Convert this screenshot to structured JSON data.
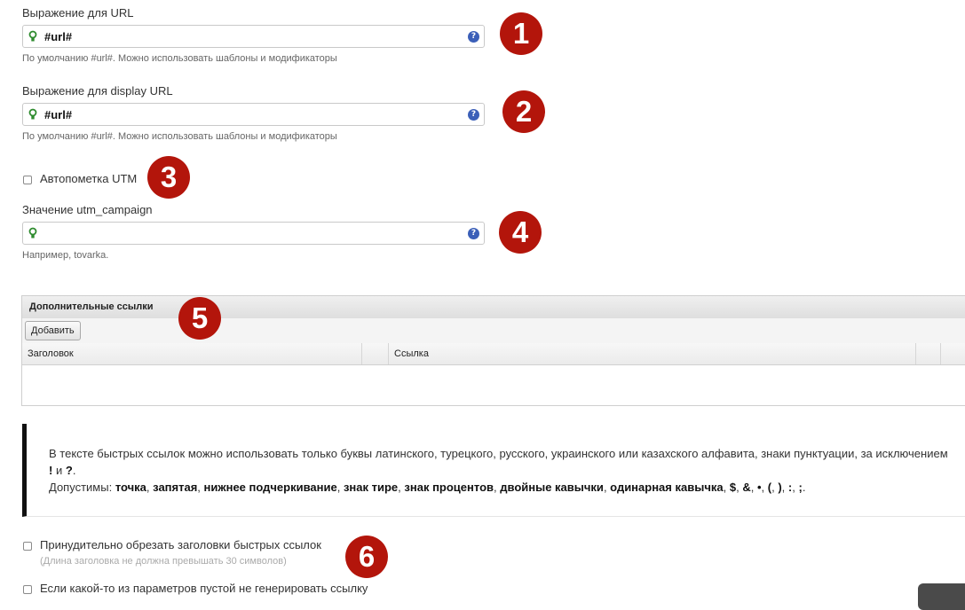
{
  "url_expr": {
    "label": "Выражение для URL",
    "value": "#url#",
    "hint": "По умолчанию #url#. Можно использовать шаблоны и модификаторы"
  },
  "display_url_expr": {
    "label": "Выражение для display URL",
    "value": "#url#",
    "hint": "По умолчанию #url#. Можно использовать шаблоны и модификаторы"
  },
  "utm_autotag": {
    "label": "Автопометка UTM"
  },
  "utm_campaign": {
    "label": "Значение utm_campaign",
    "value": "",
    "hint": "Например, tovarka."
  },
  "extra_links": {
    "title": "Дополнительные ссылки",
    "add_button": "Добавить",
    "columns": [
      "Заголовок",
      "Ссылка"
    ]
  },
  "note": {
    "line1": "В тексте быстрых ссылок можно использовать только буквы латинского, турецкого, русского, украинского или казахского алфавита, знаки пунктуации, за исключением",
    "excl_1": "!",
    "and": "и",
    "excl_2": "?",
    "dot_end": ".",
    "allowed_prefix": "Допустимы:",
    "allowed": [
      "точка",
      "запятая",
      "нижнее подчеркивание",
      "знак тире",
      "знак процентов",
      "двойные кавычки",
      "одинарная кавычка",
      "$",
      "&",
      "•",
      "(",
      ")",
      ":",
      ";"
    ]
  },
  "truncate_titles": {
    "label": "Принудительно обрезать заголовки быстрых ссылок",
    "hint": "(Длина заголовка не должна превышать 30 символов)"
  },
  "skip_empty": {
    "label": "Если какой-то из параметров пустой не генерировать ссылку"
  },
  "badges": [
    "1",
    "2",
    "3",
    "4",
    "5",
    "6"
  ],
  "help_glyph": "?",
  "colors": {
    "badge": "#b3150b",
    "help": "#3b5fb8",
    "bulb": "#2e8b2e"
  }
}
